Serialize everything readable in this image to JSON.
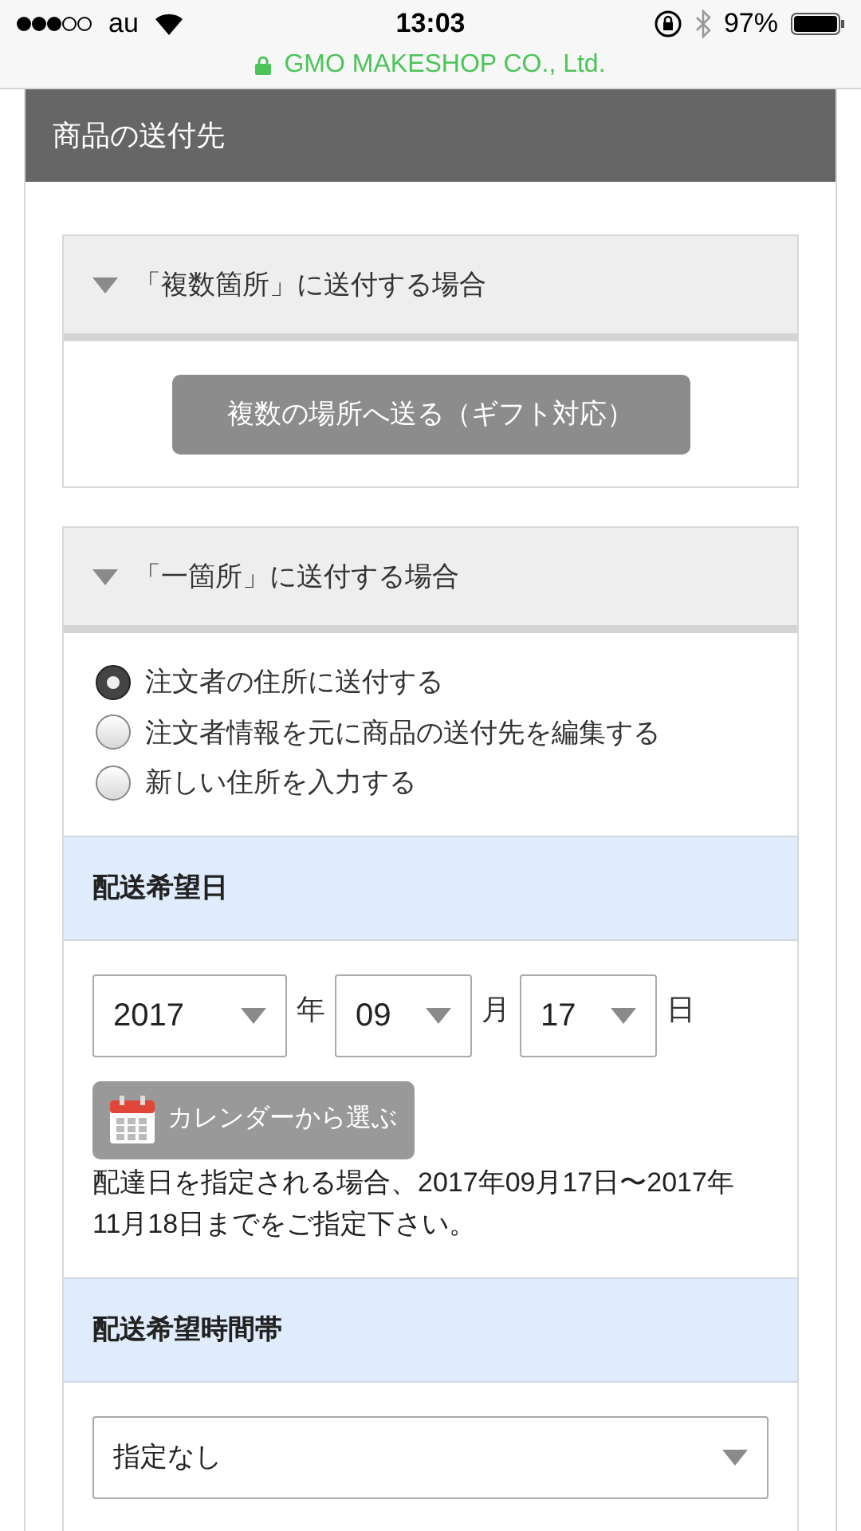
{
  "status_bar": {
    "carrier": "au",
    "time": "13:03",
    "battery": "97%",
    "site": "GMO MAKESHOP CO., Ltd."
  },
  "panel": {
    "title": "商品の送付先"
  },
  "multiple": {
    "title": "「複数箇所」に送付する場合",
    "button": "複数の場所へ送る（ギフト対応）"
  },
  "single": {
    "title": "「一箇所」に送付する場合",
    "options": [
      {
        "label": "注文者の住所に送付する",
        "selected": true
      },
      {
        "label": "注文者情報を元に商品の送付先を編集する",
        "selected": false
      },
      {
        "label": "新しい住所を入力する",
        "selected": false
      }
    ]
  },
  "delivery_date": {
    "title": "配送希望日",
    "selects": [
      {
        "value": "2017",
        "unit": "年"
      },
      {
        "value": "09",
        "unit": "月"
      },
      {
        "value": "17",
        "unit": "日"
      }
    ],
    "calendar_button": "カレンダーから選ぶ",
    "note": "配達日を指定される場合、2017年09月17日〜2017年11月18日までをご指定下さい。"
  },
  "delivery_time": {
    "title": "配送希望時間帯",
    "value": "指定なし"
  }
}
